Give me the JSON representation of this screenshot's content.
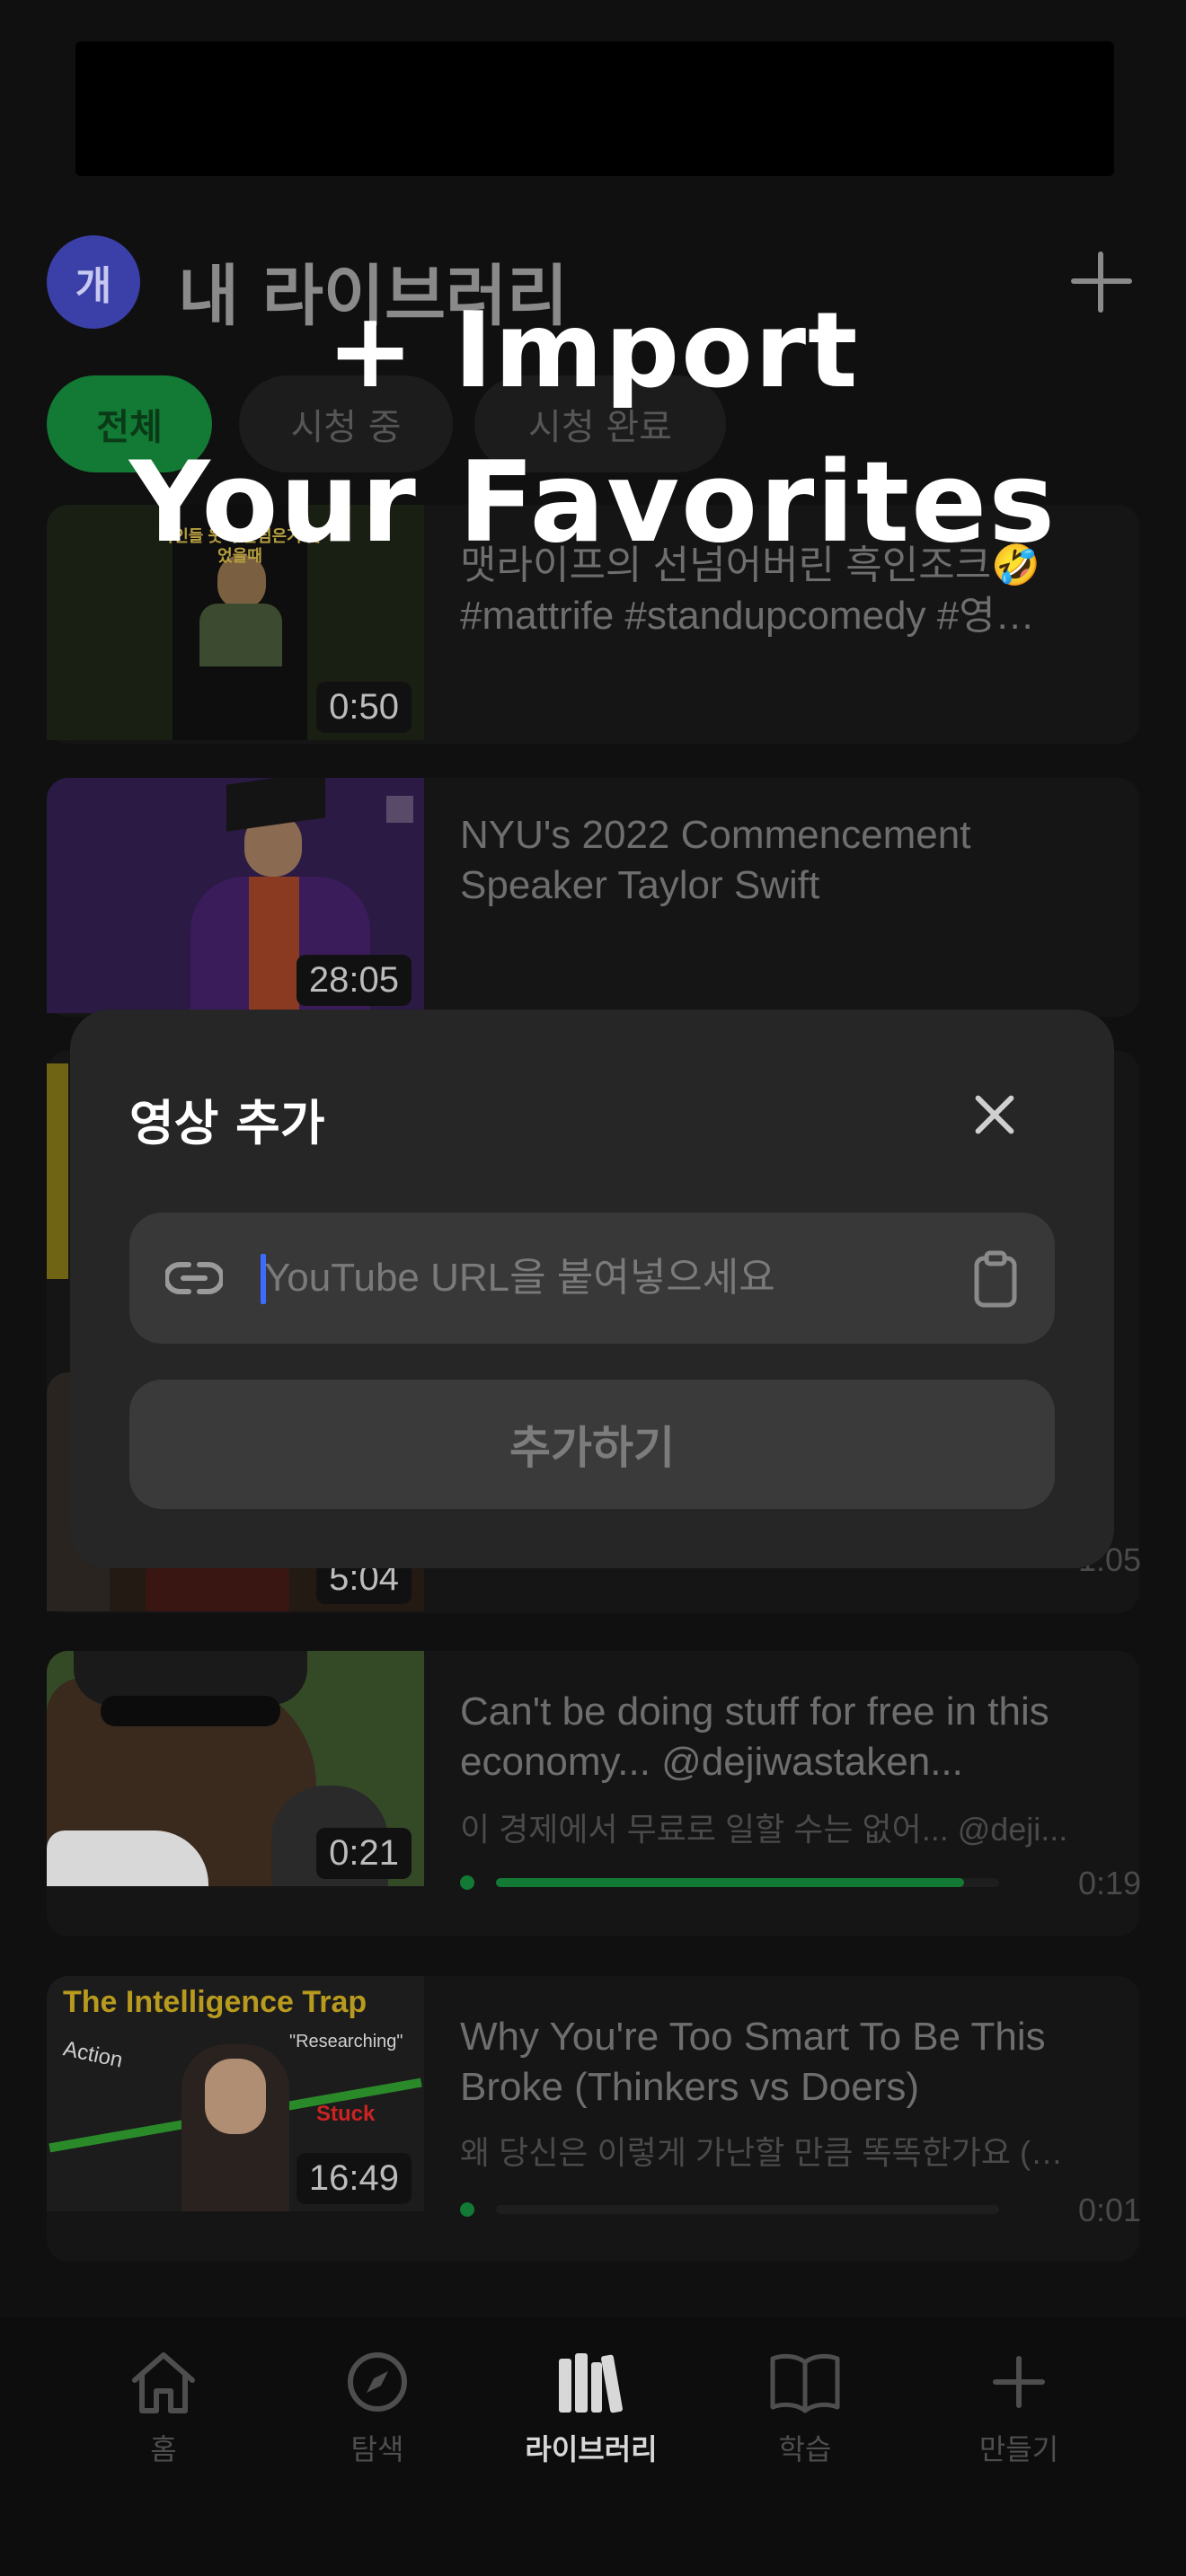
{
  "header": {
    "avatar_initial": "개",
    "title": "내 라이브러리"
  },
  "filters": [
    {
      "label": "전체",
      "active": true
    },
    {
      "label": "시청 중",
      "active": false
    },
    {
      "label": "시청 완료",
      "active": false
    }
  ],
  "overlay": {
    "line1": "+ Import",
    "line2": "Your Favorites"
  },
  "videos": [
    {
      "title": "맷라이프의 선넘어버린 흑인조크🤣 #mattrife #standupcomedy #영…",
      "duration": "0:50",
      "thumb_caption": "흑인들 웃어 선넘은거 웃었을때"
    },
    {
      "title": "NYU's 2022 Commencement Speaker Taylor Swift",
      "duration": "28:05"
    },
    {
      "duration": "5:04",
      "time": "1:05"
    },
    {
      "title": "Can't be doing stuff for free in this economy... @dejiwastaken...",
      "subtitle": "이 경제에서 무료로 일할 수는 없어... @deji...",
      "duration": "0:21",
      "progress": 0.93,
      "time": "0:19"
    },
    {
      "title": "Why You're Too Smart To Be This Broke (Thinkers vs Doers)",
      "subtitle": "왜 당신은 이렇게 가난할 만큼 똑똑한가요 (…",
      "duration": "16:49",
      "progress": 0.0,
      "time": "0:01",
      "thumb_title": "The Intelligence Trap",
      "thumb_action": "Action",
      "thumb_researching": "\"Researching\"",
      "thumb_stuck": "Stuck"
    }
  ],
  "modal": {
    "title": "영상 추가",
    "url_placeholder": "YouTube URL을 붙여넣으세요",
    "url_value": "",
    "submit_label": "추가하기"
  },
  "tabs": [
    {
      "label": "홈",
      "icon": "home-icon",
      "active": false
    },
    {
      "label": "탐색",
      "icon": "compass-icon",
      "active": false
    },
    {
      "label": "라이브러리",
      "icon": "library-icon",
      "active": true
    },
    {
      "label": "학습",
      "icon": "book-icon",
      "active": false
    },
    {
      "label": "만들기",
      "icon": "plus-icon",
      "active": false
    }
  ],
  "colors": {
    "accent": "#127a34",
    "modal_bg": "#262626",
    "cursor": "#3d6bff"
  }
}
